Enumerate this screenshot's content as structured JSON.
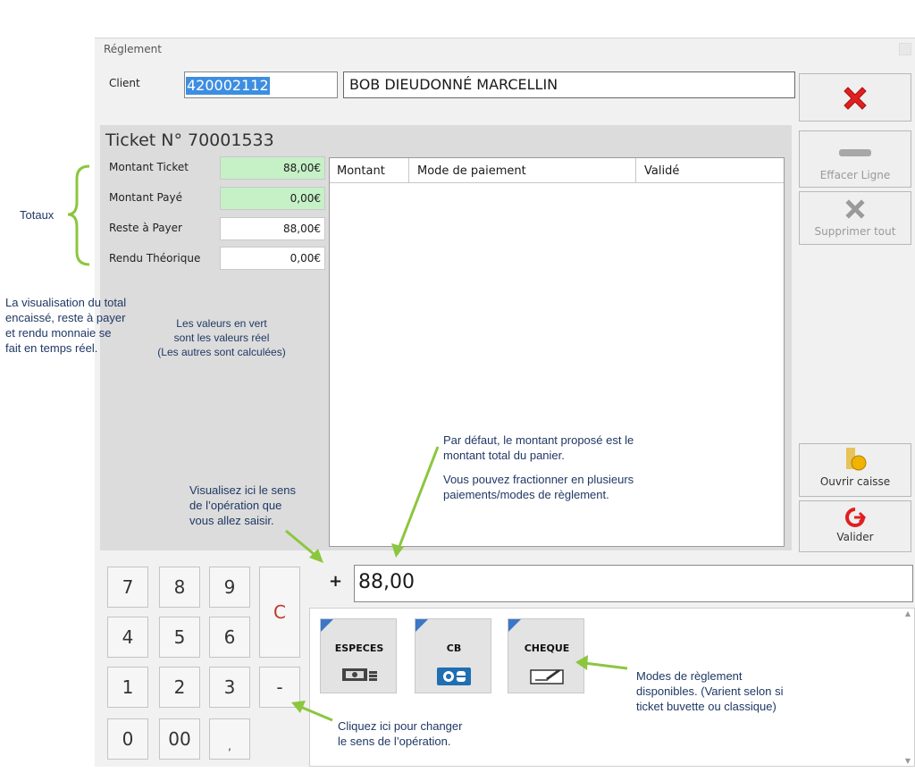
{
  "window": {
    "title": "Réglement"
  },
  "client": {
    "label": "Client",
    "code": "420002112",
    "name": "BOB DIEUDONNÉ MARCELLIN"
  },
  "ticket": {
    "title": "Ticket N° 70001533",
    "fields": [
      {
        "label": "Montant Ticket",
        "value": "88,00€",
        "real": true
      },
      {
        "label": "Montant Payé",
        "value": "0,00€",
        "real": true
      },
      {
        "label": "Reste à Payer",
        "value": "88,00€",
        "real": false
      },
      {
        "label": "Rendu Théorique",
        "value": "0,00€",
        "real": false
      }
    ]
  },
  "grid": {
    "columns": [
      "Montant",
      "Mode de paiement",
      "Validé"
    ]
  },
  "side_buttons": {
    "effacer_ligne": "Effacer Ligne",
    "supprimer_tout": "Supprimer tout",
    "ouvrir_caisse": "Ouvrir caisse",
    "valider": "Valider"
  },
  "operation": {
    "sign": "+",
    "value": "88,00"
  },
  "keypad": [
    "7",
    "8",
    "9",
    "4",
    "5",
    "6",
    "1",
    "2",
    "3",
    "0",
    "00",
    ",",
    "C",
    "-"
  ],
  "payment_modes": [
    {
      "label": "ESPECES",
      "icon": "cash-icon"
    },
    {
      "label": "CB",
      "icon": "card-icon"
    },
    {
      "label": "CHEQUE",
      "icon": "cheque-icon"
    }
  ],
  "annotations": {
    "totaux": "Totaux",
    "visualisation": [
      "La visualisation du total",
      "encaissé, reste à payer",
      "et rendu monnaie se",
      "fait en temps réel."
    ],
    "valeurs": [
      "Les valeurs en vert",
      "sont les valeurs réel",
      "(Les autres sont calculées)"
    ],
    "sens": [
      "Visualisez ici le sens",
      "de l’opération que",
      "vous allez saisir."
    ],
    "defaut": [
      "Par défaut, le montant proposé est le",
      "montant total du panier."
    ],
    "fractionner": [
      "Vous pouvez fractionner en plusieurs",
      "paiements/modes de règlement."
    ],
    "modes": [
      "Modes de règlement",
      "disponibles. (Varient selon si",
      "ticket buvette ou classique)"
    ],
    "changer": [
      "Cliquez ici pour changer",
      "le sens de l’opération."
    ]
  },
  "colors": {
    "accent_blue": "#3a77c8",
    "real_value_green": "#c6f0c6",
    "annotation_arrow": "#8cc63f",
    "cancel_red": "#e02020"
  }
}
